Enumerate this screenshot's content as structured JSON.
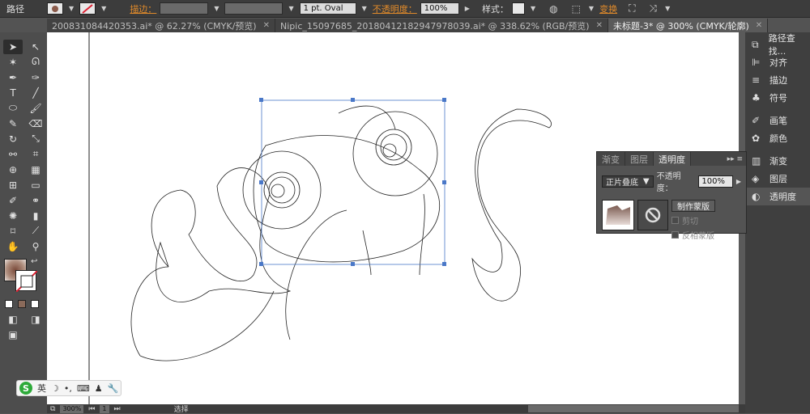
{
  "control_bar": {
    "object_type": "路径",
    "stroke_label": "描边：",
    "brush_value": "1 pt. Oval",
    "opacity_label": "不透明度：",
    "opacity_value": "100%",
    "style_label": "样式：",
    "transform_label": "变换"
  },
  "tabs": [
    {
      "label": "200831084420353.ai* @ 62.27% (CMYK/预览)",
      "active": false
    },
    {
      "label": "Nipic_15097685_20180412182947978039.ai* @ 338.62% (RGB/预览)",
      "active": false
    },
    {
      "label": "未标题-3* @ 300% (CMYK/轮廓)",
      "active": true
    }
  ],
  "dock": {
    "group1": [
      {
        "label": "路径查找...",
        "icon": "pathfinder-icon"
      },
      {
        "label": "对齐",
        "icon": "align-icon"
      },
      {
        "label": "描边",
        "icon": "stroke-icon"
      },
      {
        "label": "符号",
        "icon": "symbol-icon"
      }
    ],
    "group2": [
      {
        "label": "画笔",
        "icon": "brush-icon"
      },
      {
        "label": "颜色",
        "icon": "color-icon"
      }
    ],
    "group3": [
      {
        "label": "渐变",
        "icon": "gradient-icon"
      },
      {
        "label": "图层",
        "icon": "layers-icon"
      },
      {
        "label": "透明度",
        "icon": "transparency-icon"
      }
    ]
  },
  "transparency_panel": {
    "tabs": [
      "渐变",
      "图层",
      "透明度"
    ],
    "blend_mode": "正片叠底",
    "opacity_label": "不透明度：",
    "opacity_value": "100%",
    "make_mask_label": "制作蒙版",
    "clip_label": "剪切",
    "invert_label": "反相蒙版"
  },
  "status_bar": {
    "zoom": "300%",
    "page": "1",
    "mode": "选择"
  },
  "ime": {
    "logo": "S",
    "lang": "英"
  },
  "colors": {
    "accent_orange": "#e08a2a",
    "selection_blue": "#4a78c8"
  }
}
